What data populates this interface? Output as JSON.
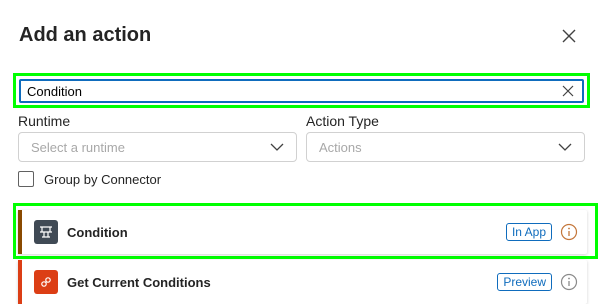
{
  "panel": {
    "title": "Add an action",
    "close_icon": "close-icon"
  },
  "search": {
    "value": "Condition",
    "clear_icon": "dismiss-icon"
  },
  "filters": {
    "runtime": {
      "label": "Runtime",
      "placeholder": "Select a runtime"
    },
    "action_type": {
      "label": "Action Type",
      "placeholder": "Actions"
    },
    "group_by_connector": {
      "label": "Group by Connector",
      "checked": false
    }
  },
  "results": [
    {
      "name": "Condition",
      "badge": "In App",
      "accent_color": "#8a4a00",
      "icon": "condition-icon",
      "icon_color": "#404a55"
    },
    {
      "name": "Get Current Conditions",
      "badge": "Preview",
      "accent_color": "#dc3e15",
      "icon": "msn-weather-icon",
      "icon_color": "#dc3e15"
    }
  ],
  "colors": {
    "highlight": "#00ff00",
    "focus_border": "#0f6cbd",
    "badge": "#0f6cbd",
    "info_icon": "#c4763a"
  }
}
